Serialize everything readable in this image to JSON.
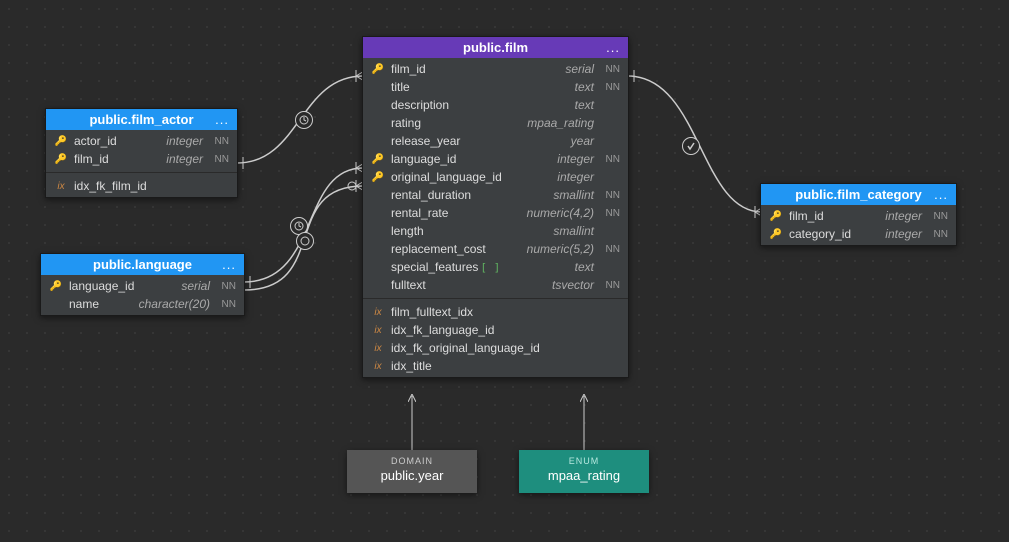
{
  "tables": {
    "film_actor": {
      "title": "public.film_actor",
      "columns": [
        {
          "name": "actor_id",
          "type": "integer",
          "nn": "NN",
          "pk": true
        },
        {
          "name": "film_id",
          "type": "integer",
          "nn": "NN",
          "pk": true
        }
      ],
      "indexes": [
        {
          "name": "idx_fk_film_id"
        }
      ]
    },
    "language": {
      "title": "public.language",
      "columns": [
        {
          "name": "language_id",
          "type": "serial",
          "nn": "NN",
          "pk": true
        },
        {
          "name": "name",
          "type": "character(20)",
          "nn": "NN"
        }
      ]
    },
    "film": {
      "title": "public.film",
      "columns": [
        {
          "name": "film_id",
          "type": "serial",
          "nn": "NN",
          "pk": true
        },
        {
          "name": "title",
          "type": "text",
          "nn": "NN"
        },
        {
          "name": "description",
          "type": "text"
        },
        {
          "name": "rating",
          "type": "mpaa_rating"
        },
        {
          "name": "release_year",
          "type": "year"
        },
        {
          "name": "language_id",
          "type": "integer",
          "nn": "NN",
          "fk": true
        },
        {
          "name": "original_language_id",
          "type": "integer",
          "fk": true
        },
        {
          "name": "rental_duration",
          "type": "smallint",
          "nn": "NN"
        },
        {
          "name": "rental_rate",
          "type": "numeric(4,2)",
          "nn": "NN"
        },
        {
          "name": "length",
          "type": "smallint"
        },
        {
          "name": "replacement_cost",
          "type": "numeric(5,2)",
          "nn": "NN"
        },
        {
          "name": "special_features",
          "type": "text",
          "array": true
        },
        {
          "name": "fulltext",
          "type": "tsvector",
          "nn": "NN"
        }
      ],
      "indexes": [
        {
          "name": "film_fulltext_idx"
        },
        {
          "name": "idx_fk_language_id"
        },
        {
          "name": "idx_fk_original_language_id"
        },
        {
          "name": "idx_title"
        }
      ]
    },
    "film_category": {
      "title": "public.film_category",
      "columns": [
        {
          "name": "film_id",
          "type": "integer",
          "nn": "NN",
          "pk": true
        },
        {
          "name": "category_id",
          "type": "integer",
          "nn": "NN",
          "pk": true
        }
      ]
    }
  },
  "types": {
    "domain": {
      "kind": "DOMAIN",
      "name": "public.year"
    },
    "enum": {
      "kind": "ENUM",
      "name": "mpaa_rating"
    }
  },
  "labels": {
    "ix": "ix",
    "nn": "NN",
    "dots": "..."
  },
  "colors": {
    "header_blue": "#2196f3",
    "header_purple": "#673ab7",
    "enum_bg": "#1e8e7e"
  }
}
